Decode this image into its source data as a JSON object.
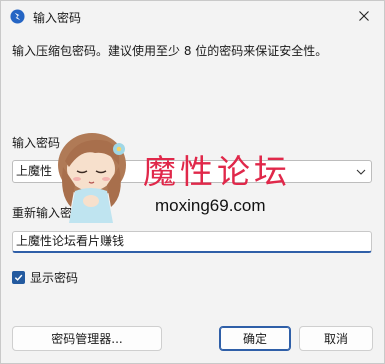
{
  "window": {
    "title": "输入密码"
  },
  "intro_text": "输入压缩包密码。建议使用至少 8 位的密码来保证安全性。",
  "password_combo": {
    "label": "输入密码",
    "value": "上魔性"
  },
  "reenter": {
    "label": "重新输入密",
    "value": "上魔性论坛看片赚钱"
  },
  "show_password": {
    "label": "显示密码",
    "checked": true
  },
  "buttons": {
    "manager": "密码管理器...",
    "ok": "确定",
    "cancel": "取消"
  },
  "watermark": {
    "title": "魔性论坛",
    "url": "moxing69.com"
  },
  "colors": {
    "accent": "#2f5fa8",
    "watermark_red": "#e0284a"
  }
}
